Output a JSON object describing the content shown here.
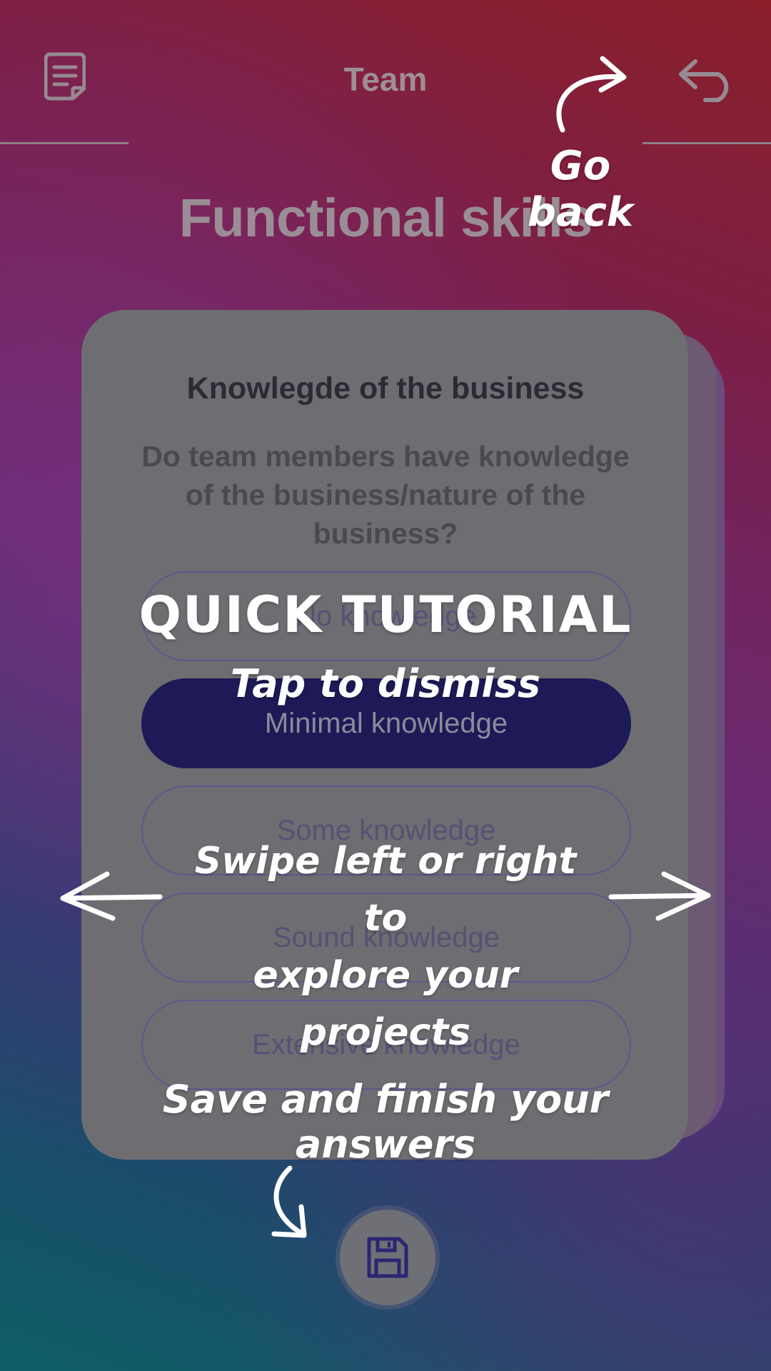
{
  "header": {
    "title": "Team",
    "notes_icon": "document-lines-icon",
    "back_icon": "undo-back-arrow-icon"
  },
  "section_title": "Functional skills",
  "card": {
    "title": "Knowlegde of the business",
    "question": "Do team members have knowledge of the business/nature of the business?",
    "options": [
      {
        "label": "No knowledge",
        "selected": false
      },
      {
        "label": "Minimal knowledge",
        "selected": true
      },
      {
        "label": "Some knowledge",
        "selected": false
      },
      {
        "label": "Sound knowledge",
        "selected": false
      },
      {
        "label": "Extensive knowledge",
        "selected": false
      }
    ]
  },
  "save_button": {
    "icon": "floppy-disk-icon"
  },
  "tutorial": {
    "title": "QUICK TUTORIAL",
    "dismiss": "Tap to dismiss",
    "go_back": "Go back",
    "swipe_line1": "Swipe left or right to",
    "swipe_line2": "explore your projects",
    "save": "Save and finish your answers"
  },
  "colors": {
    "selected_option": "#1d1a57",
    "card": "#6e6e72",
    "overlay_text": "#ffffff"
  }
}
